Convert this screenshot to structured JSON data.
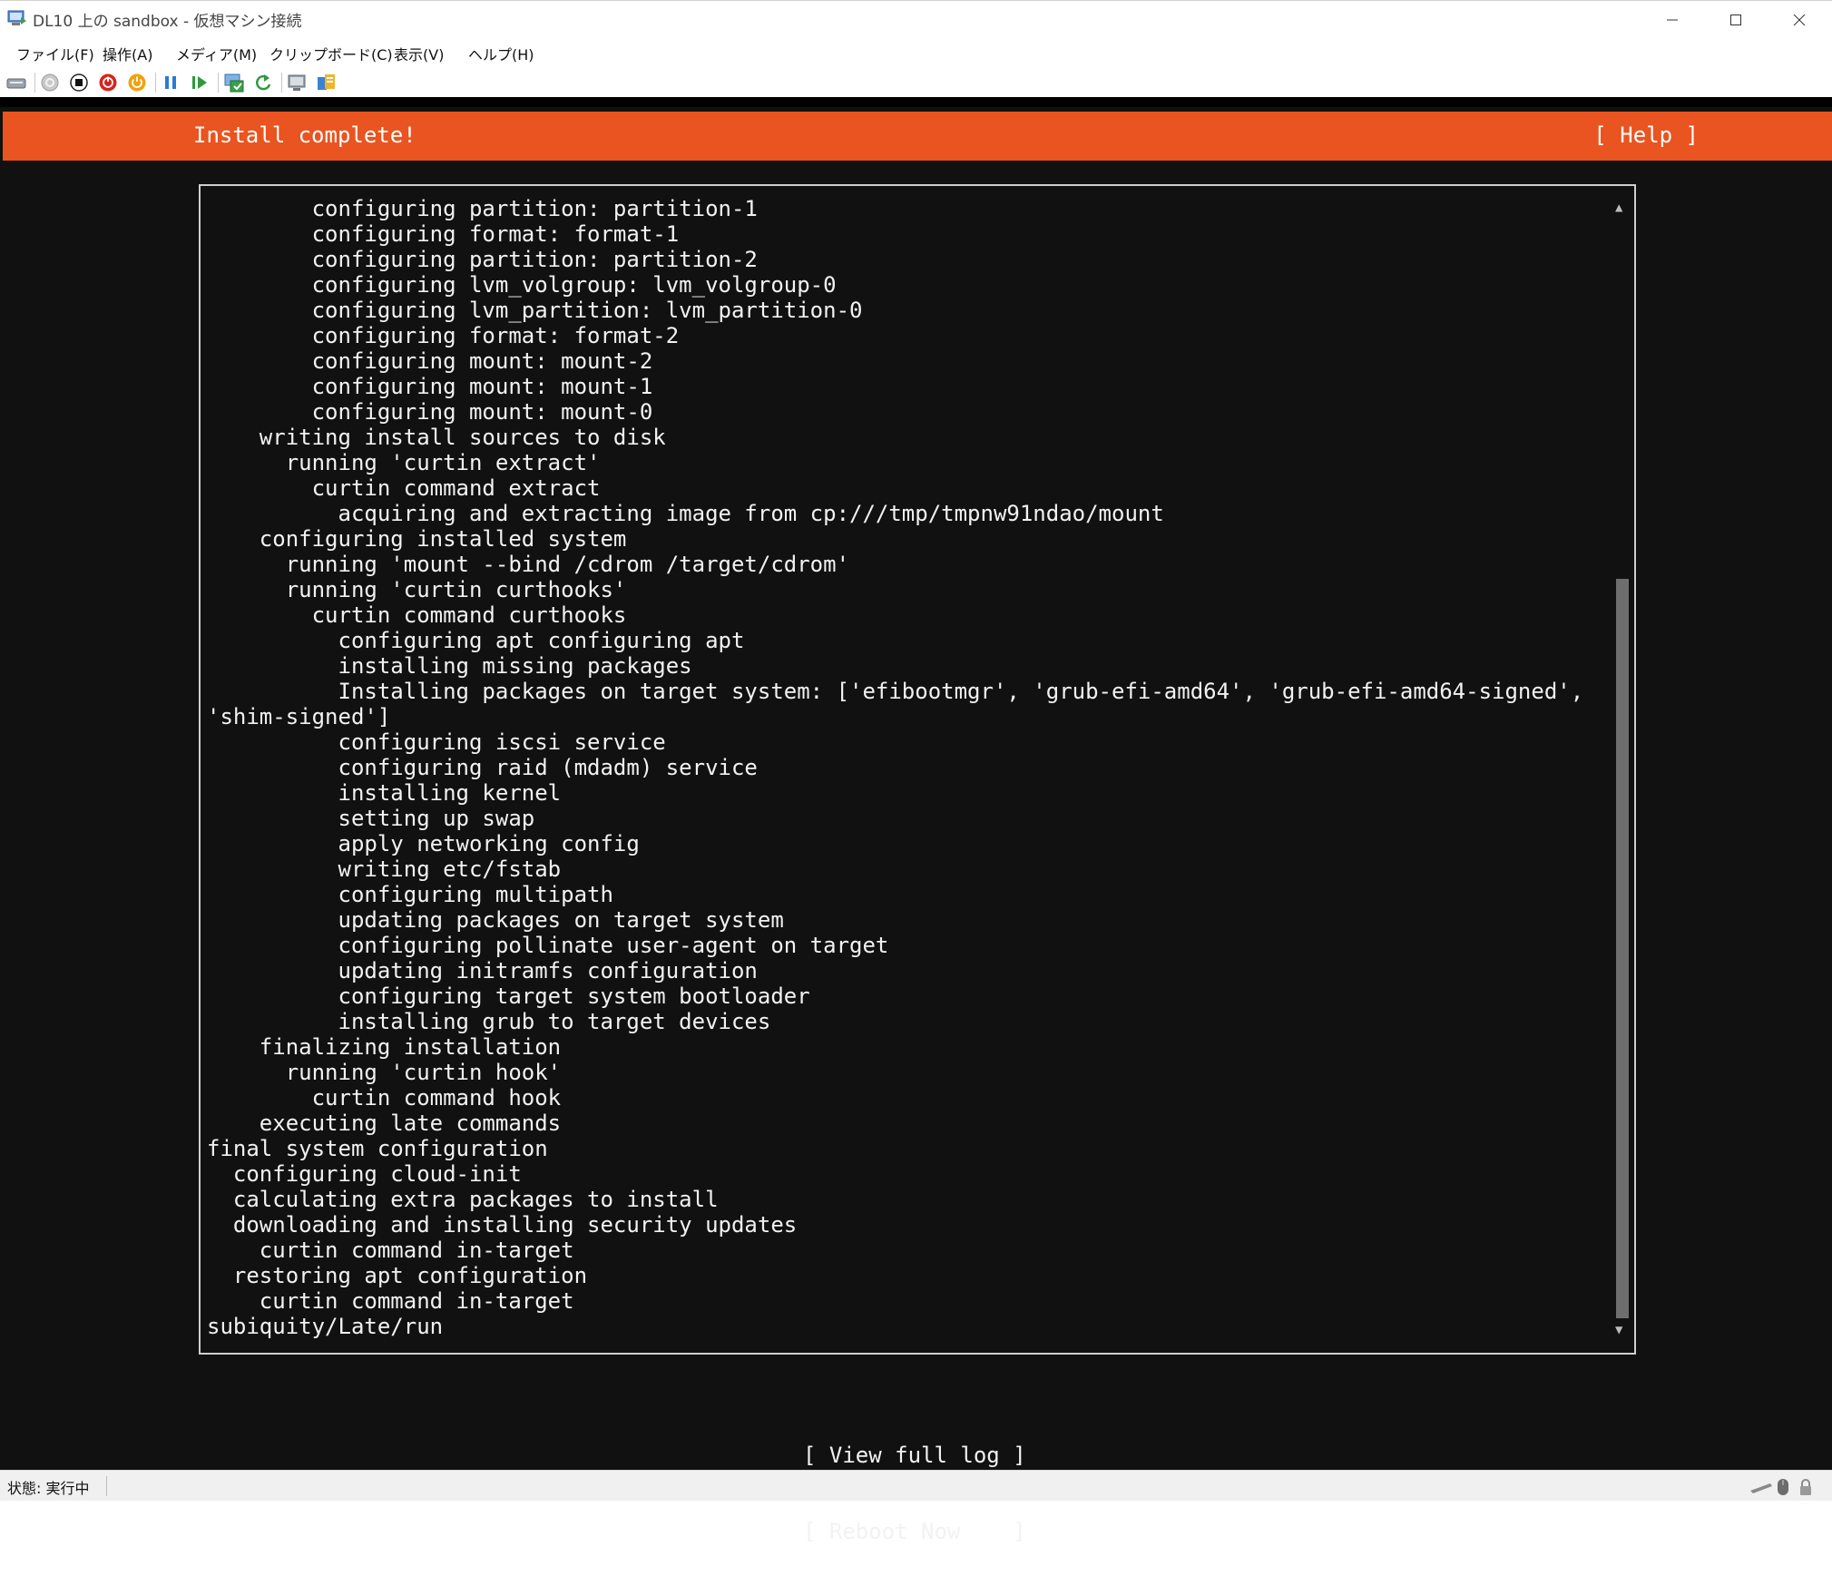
{
  "window": {
    "title": "DL10 上の sandbox - 仮想マシン接続"
  },
  "menu": [
    "ファイル(F)",
    "操作(A)",
    "メディア(M)",
    "クリップボード(C)",
    "表示(V)",
    "ヘルプ(H)"
  ],
  "toolbar": {
    "icons": [
      "ctrl-alt-del-icon",
      "start-icon",
      "turn-off-icon",
      "shut-down-icon",
      "power-icon",
      "pause-icon",
      "resume-icon",
      "checkpoint-icon",
      "revert-icon",
      "enhanced-session-icon",
      "share-icon"
    ]
  },
  "installer": {
    "header_title": "Install complete!",
    "help_label": "[ Help ]",
    "log_lines": [
      "        configuring partition: partition-1",
      "        configuring format: format-1",
      "        configuring partition: partition-2",
      "        configuring lvm_volgroup: lvm_volgroup-0",
      "        configuring lvm_partition: lvm_partition-0",
      "        configuring format: format-2",
      "        configuring mount: mount-2",
      "        configuring mount: mount-1",
      "        configuring mount: mount-0",
      "    writing install sources to disk",
      "      running 'curtin extract'",
      "        curtin command extract",
      "          acquiring and extracting image from cp:///tmp/tmpnw91ndao/mount",
      "    configuring installed system",
      "      running 'mount --bind /cdrom /target/cdrom'",
      "      running 'curtin curthooks'",
      "        curtin command curthooks",
      "          configuring apt configuring apt",
      "          installing missing packages",
      "          Installing packages on target system: ['efibootmgr', 'grub-efi-amd64', 'grub-efi-amd64-signed',",
      "'shim-signed']",
      "          configuring iscsi service",
      "          configuring raid (mdadm) service",
      "          installing kernel",
      "          setting up swap",
      "          apply networking config",
      "          writing etc/fstab",
      "          configuring multipath",
      "          updating packages on target system",
      "          configuring pollinate user-agent on target",
      "          updating initramfs configuration",
      "          configuring target system bootloader",
      "          installing grub to target devices",
      "    finalizing installation",
      "      running 'curtin hook'",
      "        curtin command hook",
      "    executing late commands",
      "final system configuration",
      "  configuring cloud-init",
      "  calculating extra packages to install",
      "  downloading and installing security updates",
      "    curtin command in-target",
      "  restoring apt configuration",
      "    curtin command in-target",
      "subiquity/Late/run"
    ],
    "view_log_label": "[ View full log ]",
    "reboot_label": "[ Reboot Now    ]"
  },
  "statusbar": {
    "status_text": "状態: 実行中"
  },
  "colors": {
    "ubuntu_orange": "#e95420",
    "console_bg": "#111111",
    "console_fg": "#f2f2f2"
  }
}
